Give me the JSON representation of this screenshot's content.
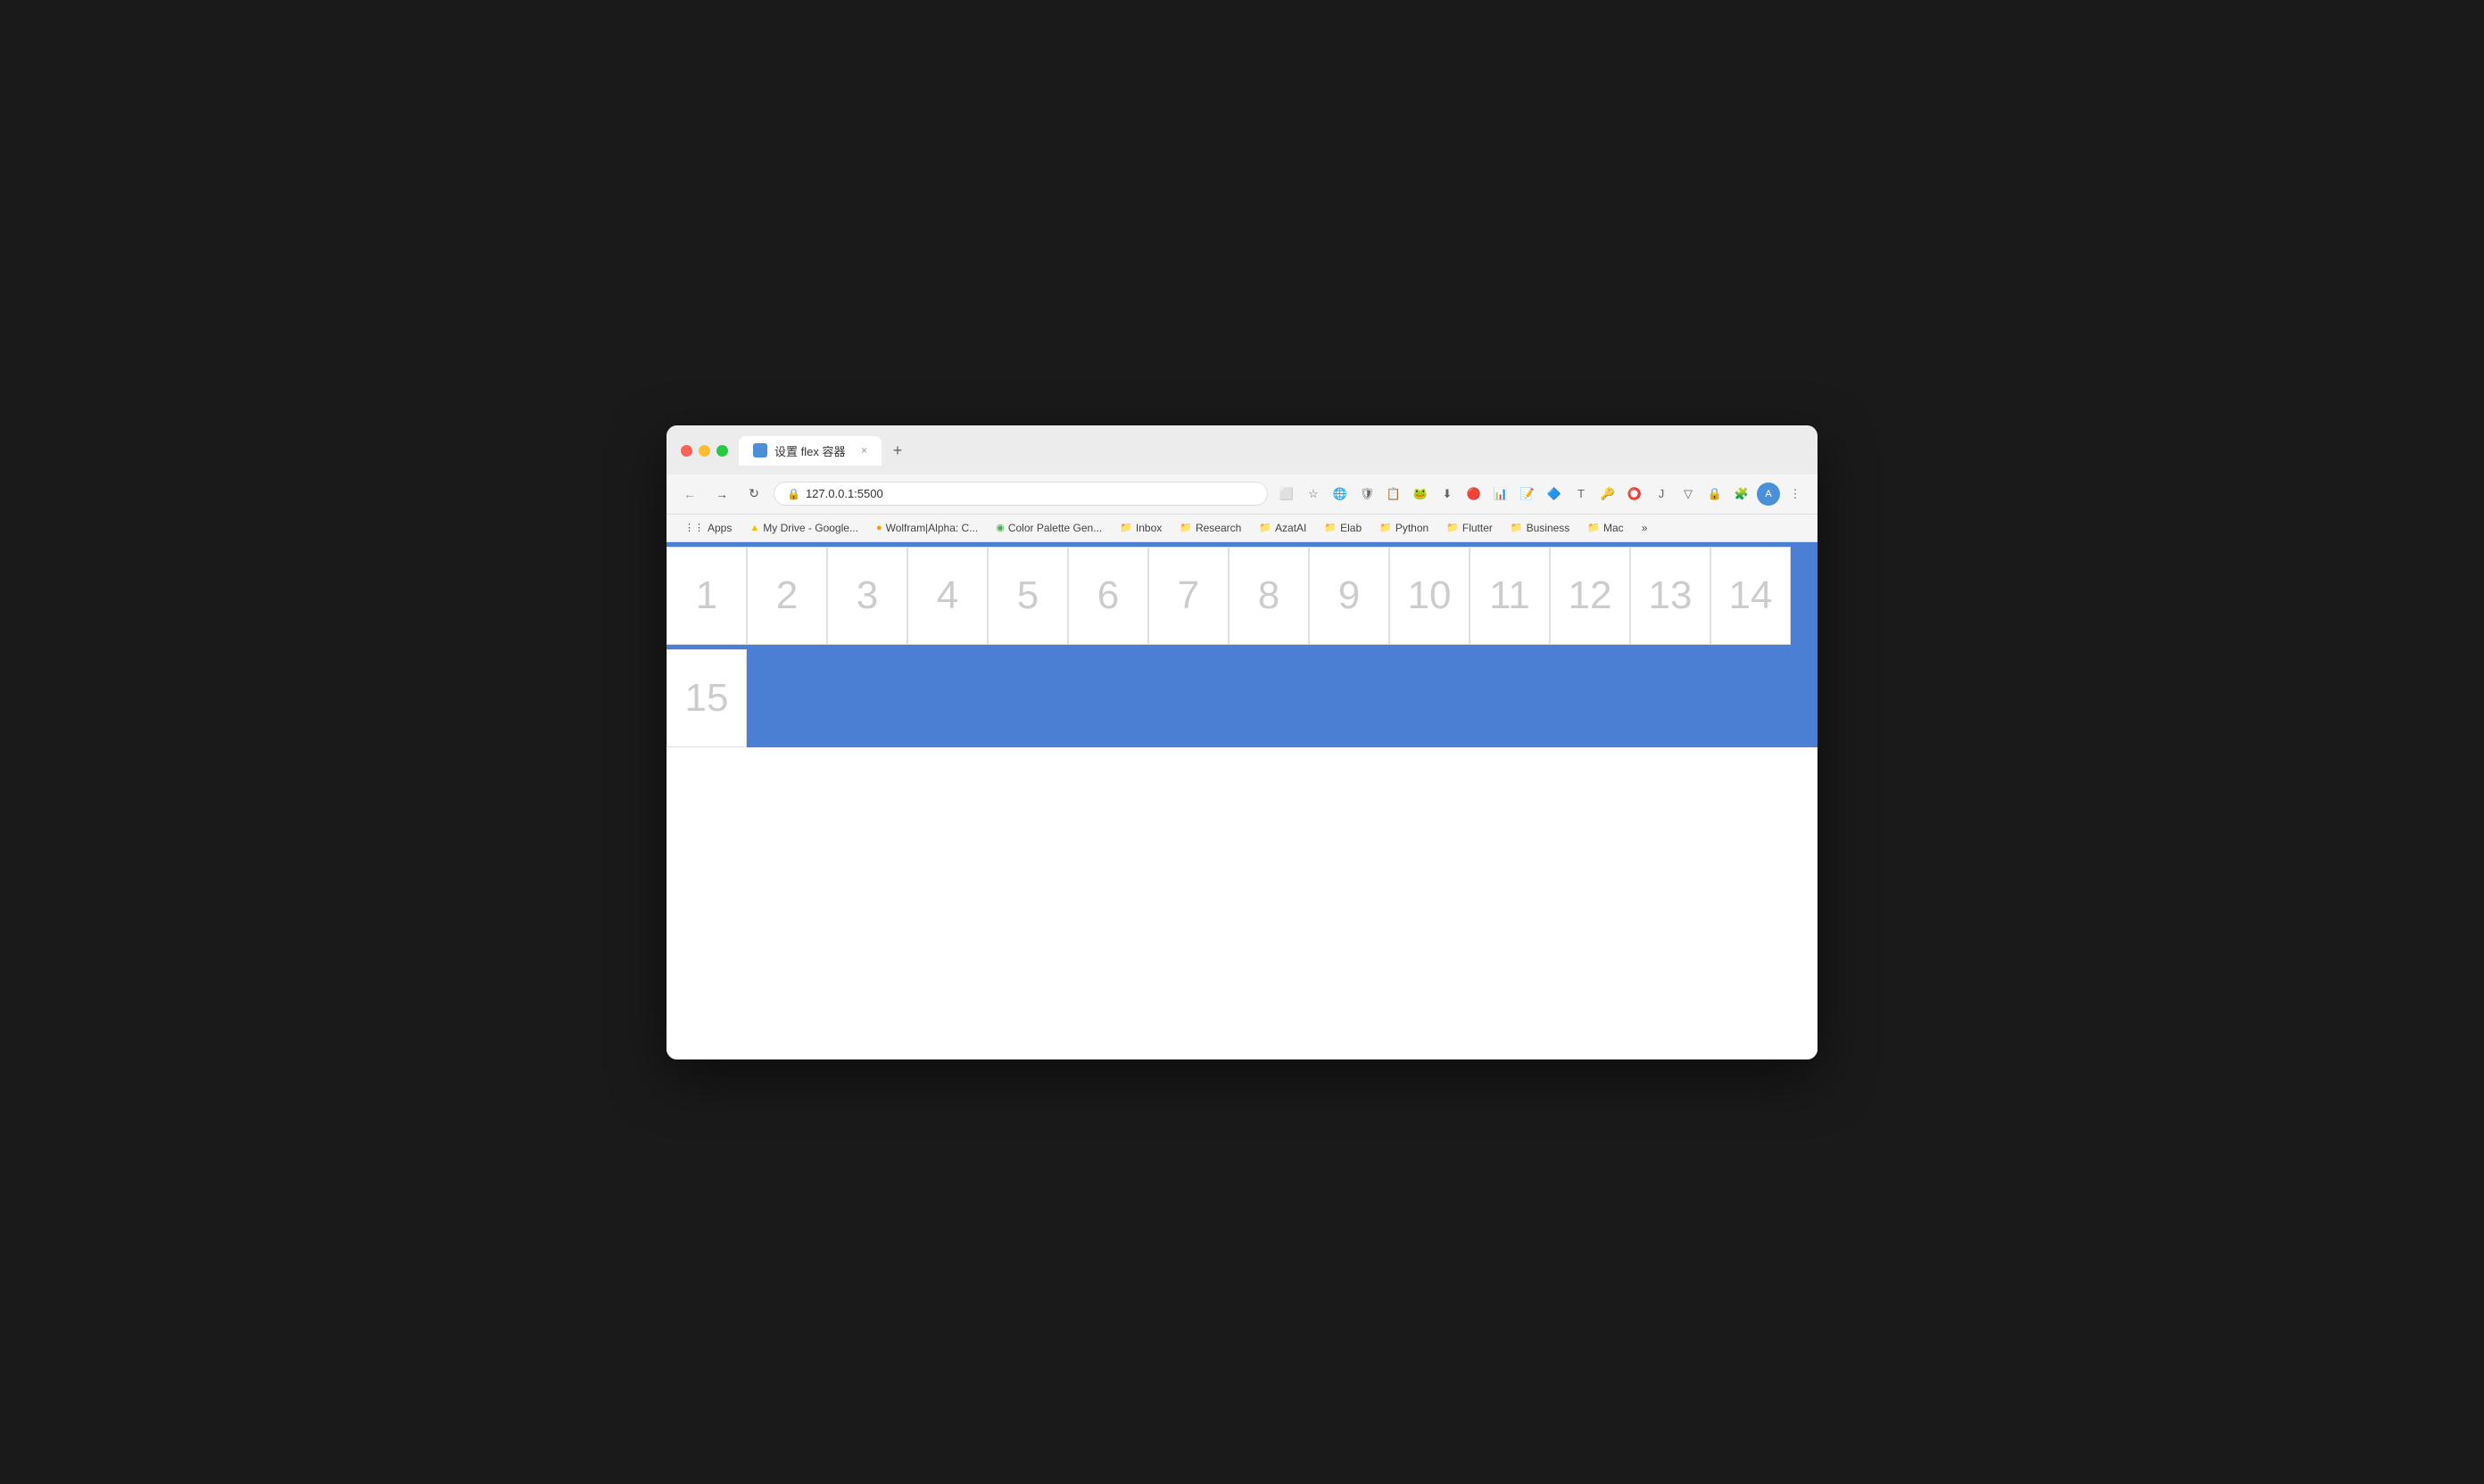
{
  "browser": {
    "tab_title": "设置 flex 容器",
    "tab_close": "×",
    "tab_new": "+",
    "address": "127.0.0.1:5500",
    "nav_back": "←",
    "nav_forward": "→",
    "nav_refresh": "↻"
  },
  "bookmarks": [
    {
      "label": "Apps",
      "icon": "⋮⋮⋮"
    },
    {
      "label": "My Drive - Google...",
      "icon": "▲"
    },
    {
      "label": "Wolfram|Alpha: C...",
      "icon": "●"
    },
    {
      "label": "Color Palette Gen...",
      "icon": "◉"
    },
    {
      "label": "Inbox",
      "icon": "📁"
    },
    {
      "label": "Research",
      "icon": "📁"
    },
    {
      "label": "AzatAI",
      "icon": "📁"
    },
    {
      "label": "Elab",
      "icon": "📁"
    },
    {
      "label": "Python",
      "icon": "📁"
    },
    {
      "label": "Flutter",
      "icon": "📁"
    },
    {
      "label": "Business",
      "icon": "📁"
    },
    {
      "label": "Mac",
      "icon": "📁"
    }
  ],
  "flex_items": [
    {
      "number": "1"
    },
    {
      "number": "2"
    },
    {
      "number": "3"
    },
    {
      "number": "4"
    },
    {
      "number": "5"
    },
    {
      "number": "6"
    },
    {
      "number": "7"
    },
    {
      "number": "8"
    },
    {
      "number": "9"
    },
    {
      "number": "10"
    },
    {
      "number": "11"
    },
    {
      "number": "12"
    },
    {
      "number": "13"
    },
    {
      "number": "14"
    },
    {
      "number": "15"
    }
  ],
  "colors": {
    "blue_bg": "#4a7fd4",
    "item_bg": "#ffffff",
    "item_border": "#e0e0e0",
    "item_text": "#cccccc"
  }
}
